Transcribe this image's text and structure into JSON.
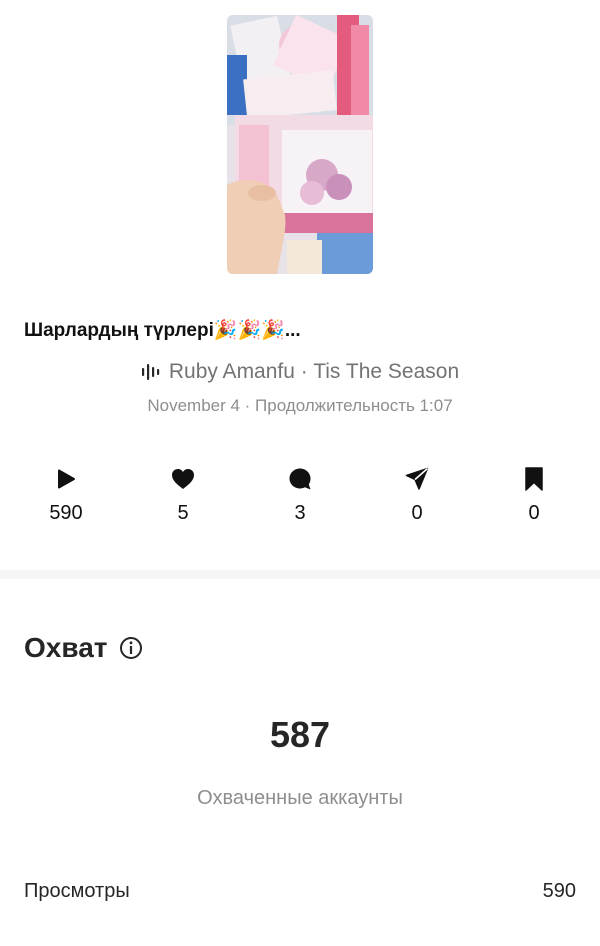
{
  "post": {
    "caption": "Шарлардың түрлері🎉🎉🎉...",
    "audio": "Ruby Amanfu · Tis The Season",
    "meta": "November 4 · Продолжительность 1:07"
  },
  "stats": {
    "plays": "590",
    "likes": "5",
    "comments": "3",
    "shares": "0",
    "saves": "0"
  },
  "reach": {
    "title": "Охват",
    "value": "587",
    "label": "Охваченные аккаунты"
  },
  "rows": {
    "views_label": "Просмотры",
    "views_value": "590"
  },
  "icons": {
    "audio": "audio-waveform-icon",
    "plays": "play-icon",
    "likes": "heart-icon",
    "comments": "comment-bubble-icon",
    "shares": "send-icon",
    "saves": "bookmark-icon",
    "info": "info-icon"
  }
}
